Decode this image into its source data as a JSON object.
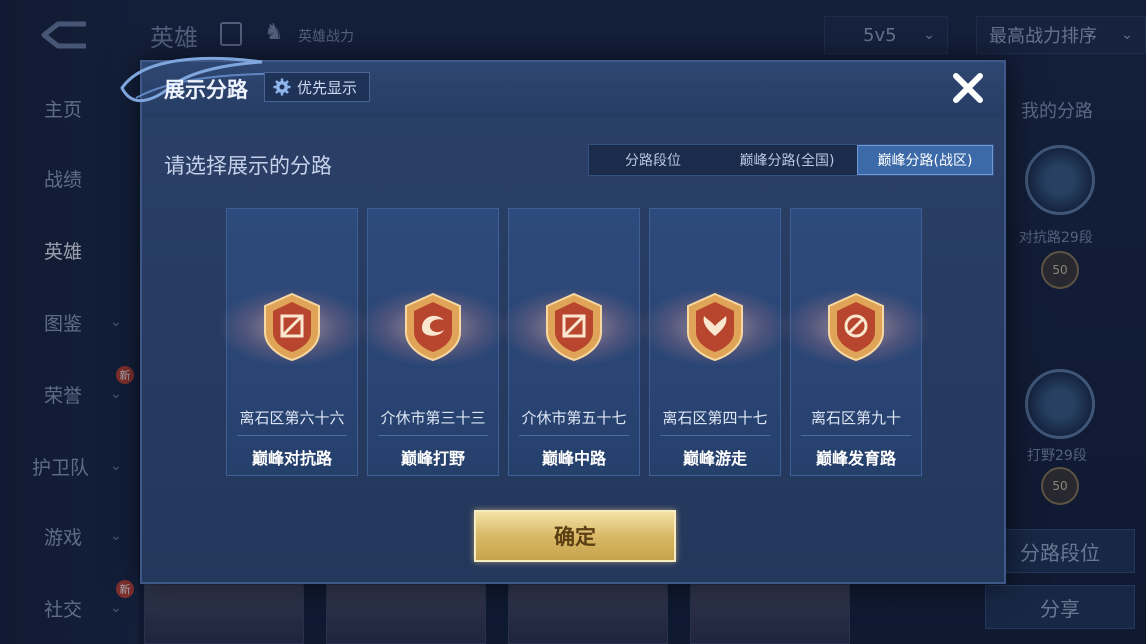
{
  "background": {
    "header": {
      "title": "英雄",
      "subtitle": "英雄战力",
      "mode_select": "5v5",
      "sort_select": "最高战力排序"
    },
    "sidebar": {
      "items": [
        {
          "label": "主页",
          "chevron": ""
        },
        {
          "label": "战绩",
          "chevron": ""
        },
        {
          "label": "英雄",
          "chevron": ""
        },
        {
          "label": "图鉴",
          "chevron": "⌄"
        },
        {
          "label": "荣誉",
          "chevron": "⌄",
          "badge": "新"
        },
        {
          "label": "护卫队",
          "chevron": "⌄"
        },
        {
          "label": "游戏",
          "chevron": "⌄"
        },
        {
          "label": "社交",
          "chevron": "⌄",
          "badge": "新"
        }
      ]
    },
    "right_panel": {
      "title": "我的分路",
      "lane1_rank": "对抗路29段",
      "lane1_coin": "50",
      "lane2_rank": "打野29段",
      "lane2_coin": "50",
      "lane_rank_button": "分路段位",
      "share_button": "分享"
    }
  },
  "modal": {
    "title": "展示分路",
    "priority_button": "优先显示",
    "prompt": "请选择展示的分路",
    "tabs": [
      {
        "label": "分路段位",
        "active": false
      },
      {
        "label": "巅峰分路(全国)",
        "active": false
      },
      {
        "label": "巅峰分路(战区)",
        "active": true
      }
    ],
    "lanes": [
      {
        "region": "离石区第六十六",
        "name": "巅峰对抗路",
        "icon": "slash-emblem-icon"
      },
      {
        "region": "介休市第三十三",
        "name": "巅峰打野",
        "icon": "dragon-emblem-icon"
      },
      {
        "region": "介休市第五十七",
        "name": "巅峰中路",
        "icon": "slash-emblem-icon"
      },
      {
        "region": "离石区第四十七",
        "name": "巅峰游走",
        "icon": "wings-emblem-icon"
      },
      {
        "region": "离石区第九十",
        "name": "巅峰发育路",
        "icon": "target-emblem-icon"
      }
    ],
    "confirm_button": "确定"
  },
  "colors": {
    "modal_bg": "#2b4068",
    "tab_active": "#3c6aa8",
    "confirm_gold": "#d9b966",
    "emblem_gold": "#e0a458",
    "emblem_red": "#b8462f"
  }
}
